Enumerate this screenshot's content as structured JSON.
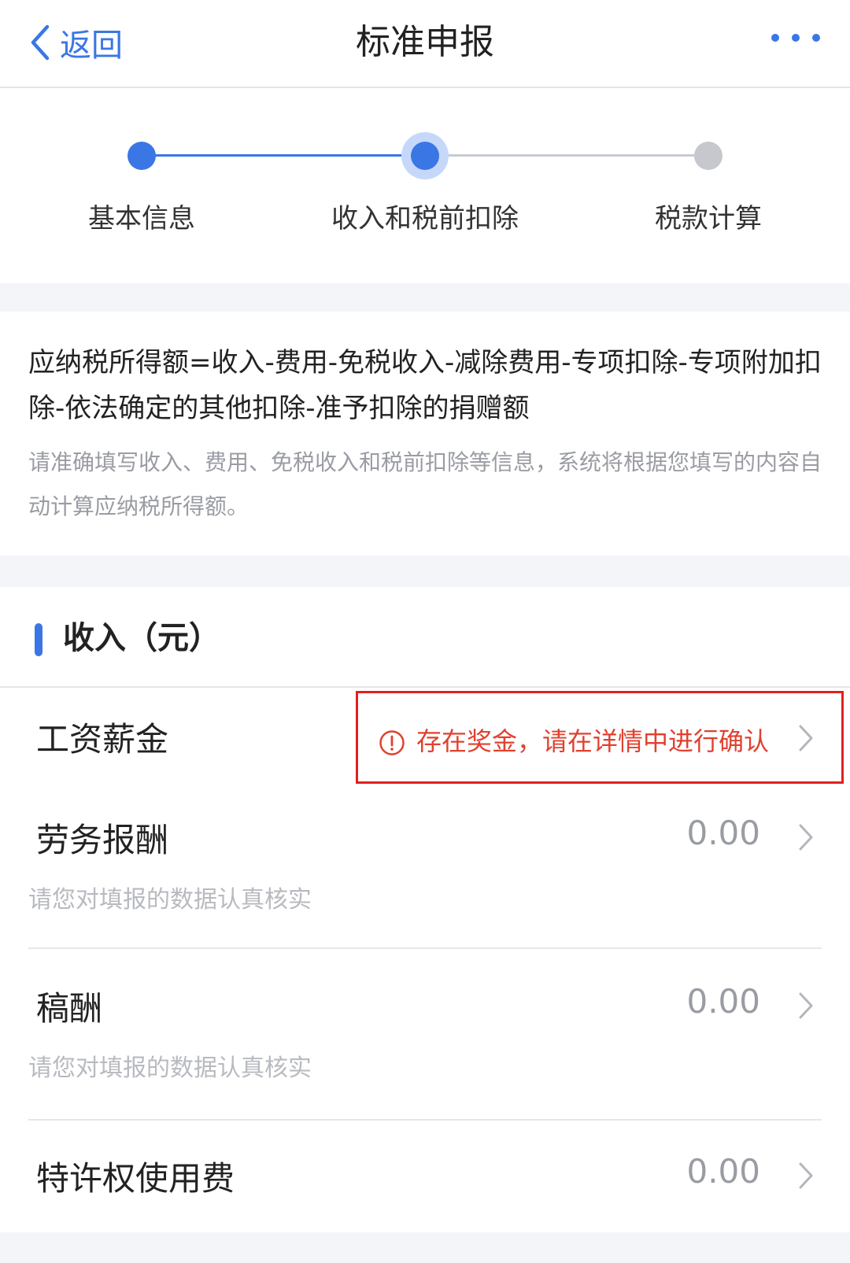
{
  "header": {
    "back_label": "返回",
    "title": "标准申报",
    "accent_color": "#3a77e4"
  },
  "stepper": {
    "steps": [
      {
        "label": "基本信息",
        "state": "done"
      },
      {
        "label": "收入和税前扣除",
        "state": "current"
      },
      {
        "label": "税款计算",
        "state": "todo"
      }
    ]
  },
  "formula": {
    "text": "应纳税所得额=收入-费用-免税收入-减除费用-专项扣除-专项附加扣除-依法确定的其他扣除-准予扣除的捐赠额",
    "note": "请准确填写收入、费用、免税收入和税前扣除等信息，系统将根据您填写的内容自动计算应纳税所得额。"
  },
  "income": {
    "section_title": "收入（元）",
    "rows": [
      {
        "label": "工资薪金",
        "warning": "存在奖金，请在详情中进行确认",
        "warning_color": "#e0412f"
      },
      {
        "label": "劳务报酬",
        "value": "0.00",
        "hint": "请您对填报的数据认真核实"
      },
      {
        "label": "稿酬",
        "value": "0.00",
        "hint": "请您对填报的数据认真核实"
      },
      {
        "label": "特许权使用费",
        "value": "0.00"
      }
    ]
  }
}
